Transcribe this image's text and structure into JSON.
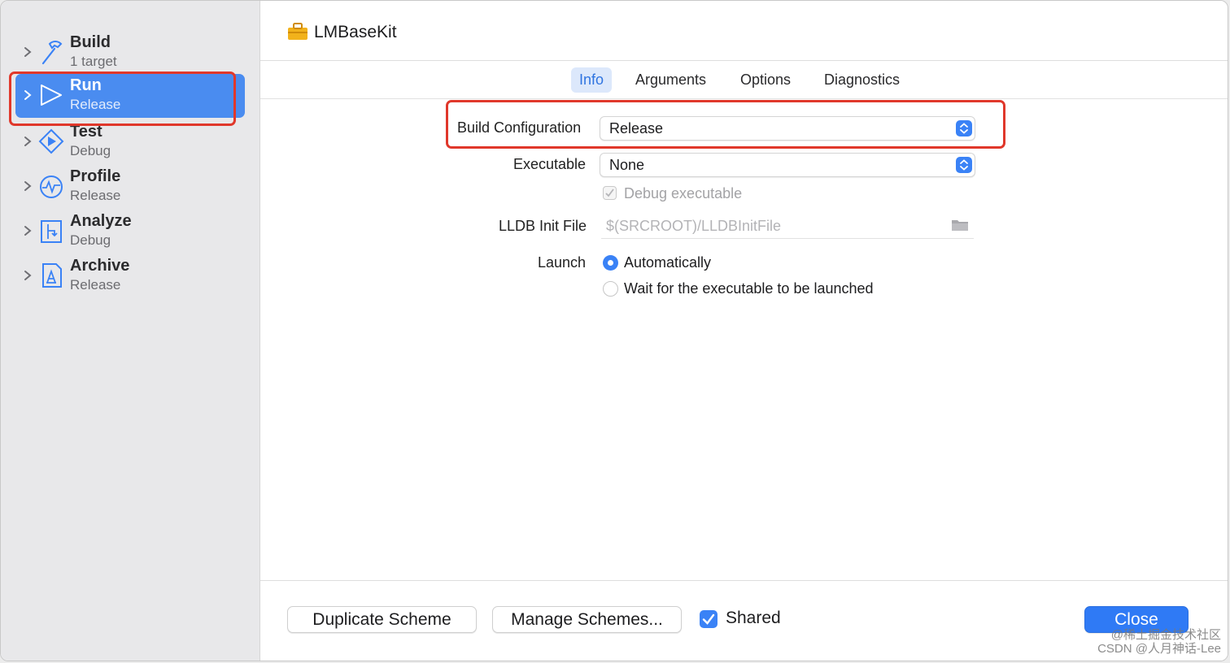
{
  "scheme": {
    "title": "LMBaseKit"
  },
  "sidebar": {
    "actions": [
      {
        "name": "Build",
        "subtitle": "1 target",
        "icon": "hammer-icon"
      },
      {
        "name": "Run",
        "subtitle": "Release",
        "icon": "play-icon",
        "selected": true
      },
      {
        "name": "Test",
        "subtitle": "Debug",
        "icon": "test-diamond-icon"
      },
      {
        "name": "Profile",
        "subtitle": "Release",
        "icon": "gauge-icon"
      },
      {
        "name": "Analyze",
        "subtitle": "Debug",
        "icon": "analyze-icon"
      },
      {
        "name": "Archive",
        "subtitle": "Release",
        "icon": "archive-icon"
      }
    ]
  },
  "tabs": [
    {
      "label": "Info",
      "active": true
    },
    {
      "label": "Arguments"
    },
    {
      "label": "Options"
    },
    {
      "label": "Diagnostics"
    }
  ],
  "info": {
    "build_configuration": {
      "label": "Build Configuration",
      "value": "Release"
    },
    "executable": {
      "label": "Executable",
      "value": "None"
    },
    "debug_executable": {
      "label": "Debug executable",
      "checked": true,
      "disabled": true
    },
    "lldb_init_file": {
      "label": "LLDB Init File",
      "placeholder": "$(SRCROOT)/LLDBInitFile"
    },
    "launch": {
      "label": "Launch",
      "options": [
        {
          "label": "Automatically",
          "selected": true
        },
        {
          "label": "Wait for the executable to be launched",
          "selected": false
        }
      ]
    }
  },
  "footer": {
    "duplicate_label": "Duplicate Scheme",
    "manage_label": "Manage Schemes...",
    "shared_label": "Shared",
    "shared_checked": true,
    "close_label": "Close"
  },
  "watermark": {
    "line1": "@稀土掘金技术社区",
    "line2": "CSDN @人月神话-Lee"
  },
  "colors": {
    "accent": "#3a82f6",
    "selection": "#4a8cf0",
    "annotation": "#e0382b"
  }
}
